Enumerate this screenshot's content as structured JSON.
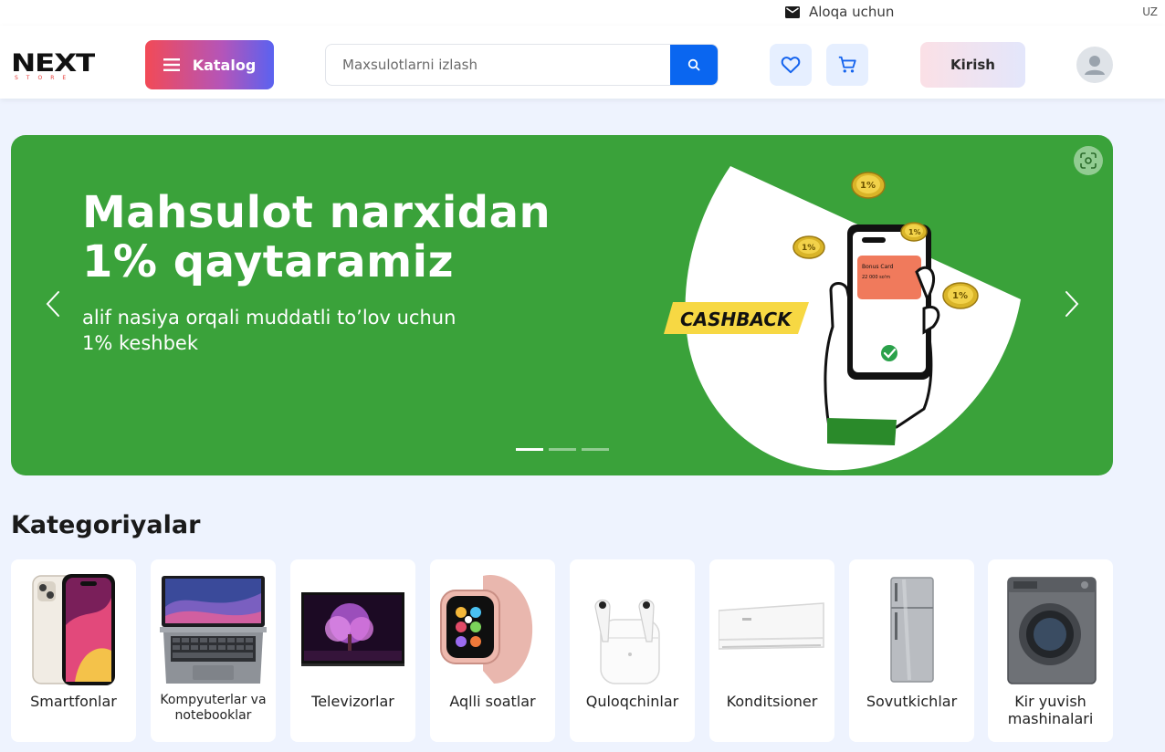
{
  "topbar": {
    "contact_label": "Aloqa uchun",
    "contact_icon": "mail-icon",
    "language": "UZ"
  },
  "header": {
    "logo_text": "NEXT",
    "logo_sub": "STORE",
    "catalog_label": "Katalog",
    "search_placeholder": "Maxsulotlarni izlash",
    "login_label": "Kirish",
    "icons": [
      "menu-icon",
      "search-icon",
      "heart-icon",
      "cart-icon",
      "user-icon"
    ]
  },
  "banner": {
    "title": "Mahsulot narxidan 1% qaytaramiz",
    "subtitle": "alif nasiya orqali muddatli to’lov uchun 1% keshbek",
    "badge": "CASHBACK",
    "card_label": "Bonus Card",
    "card_amount": "22 000 so'm",
    "coin_text": "1%",
    "slides": 3,
    "active_slide": 1,
    "bg_color": "#3aa23a"
  },
  "categories": {
    "title": "Kategoriyalar",
    "items": [
      {
        "label": "Smartfonlar"
      },
      {
        "label": "Kompyuterlar va notebooklar"
      },
      {
        "label": "Televizorlar"
      },
      {
        "label": "Aqlli soatlar"
      },
      {
        "label": "Quloqchinlar"
      },
      {
        "label": "Konditsioner"
      },
      {
        "label": "Sovutkichlar"
      },
      {
        "label": "Kir yuvish mashinalari"
      }
    ]
  },
  "colors": {
    "accent": "#0a66f0",
    "page_bg": "#eef3fe",
    "banner": "#3aa23a",
    "badge": "#f7d843"
  }
}
